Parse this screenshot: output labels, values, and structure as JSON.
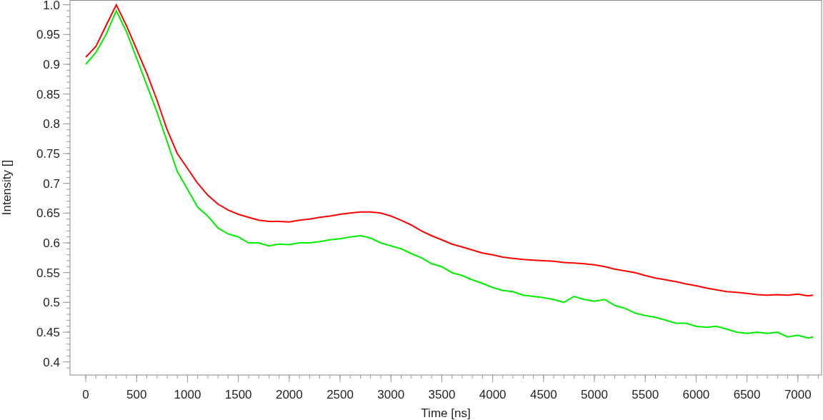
{
  "chart_data": {
    "type": "line",
    "xlabel": "Time [ns]",
    "ylabel": "Intensity []",
    "x": [
      0,
      100,
      200,
      300,
      400,
      500,
      600,
      700,
      800,
      900,
      1000,
      1100,
      1200,
      1300,
      1400,
      1500,
      1600,
      1700,
      1800,
      1900,
      2000,
      2100,
      2200,
      2300,
      2400,
      2500,
      2600,
      2700,
      2800,
      2900,
      3000,
      3100,
      3200,
      3300,
      3400,
      3500,
      3600,
      3700,
      3800,
      3900,
      4000,
      4100,
      4200,
      4300,
      4400,
      4500,
      4600,
      4700,
      4800,
      4900,
      5000,
      5100,
      5200,
      5300,
      5400,
      5500,
      5600,
      5700,
      5800,
      5900,
      6000,
      6100,
      6200,
      6300,
      6400,
      6500,
      6600,
      6700,
      6800,
      6900,
      7000,
      7100,
      7150
    ],
    "series": [
      {
        "color": "#ff0000",
        "values": [
          0.912,
          0.93,
          0.965,
          1.0,
          0.965,
          0.925,
          0.885,
          0.84,
          0.79,
          0.75,
          0.725,
          0.7,
          0.68,
          0.665,
          0.655,
          0.648,
          0.643,
          0.638,
          0.636,
          0.636,
          0.635,
          0.638,
          0.64,
          0.643,
          0.645,
          0.648,
          0.65,
          0.652,
          0.652,
          0.65,
          0.645,
          0.638,
          0.63,
          0.62,
          0.612,
          0.605,
          0.598,
          0.593,
          0.588,
          0.583,
          0.58,
          0.576,
          0.574,
          0.572,
          0.571,
          0.57,
          0.569,
          0.567,
          0.566,
          0.565,
          0.563,
          0.56,
          0.556,
          0.553,
          0.55,
          0.545,
          0.541,
          0.538,
          0.535,
          0.531,
          0.528,
          0.524,
          0.521,
          0.518,
          0.517,
          0.515,
          0.513,
          0.512,
          0.513,
          0.512,
          0.514,
          0.511,
          0.512
        ]
      },
      {
        "color": "#00ee00",
        "values": [
          0.9,
          0.92,
          0.95,
          0.99,
          0.955,
          0.91,
          0.865,
          0.82,
          0.77,
          0.72,
          0.69,
          0.66,
          0.645,
          0.625,
          0.615,
          0.61,
          0.6,
          0.6,
          0.595,
          0.598,
          0.597,
          0.6,
          0.6,
          0.602,
          0.605,
          0.607,
          0.61,
          0.612,
          0.608,
          0.6,
          0.595,
          0.59,
          0.582,
          0.575,
          0.565,
          0.56,
          0.55,
          0.545,
          0.538,
          0.532,
          0.525,
          0.52,
          0.518,
          0.512,
          0.51,
          0.508,
          0.505,
          0.5,
          0.51,
          0.505,
          0.502,
          0.505,
          0.495,
          0.49,
          0.482,
          0.478,
          0.475,
          0.47,
          0.465,
          0.465,
          0.46,
          0.458,
          0.46,
          0.455,
          0.45,
          0.448,
          0.45,
          0.448,
          0.45,
          0.442,
          0.445,
          0.44,
          0.442
        ]
      }
    ],
    "xlim": [
      -155,
      7233
    ],
    "ylim": [
      0.378,
      1.008
    ],
    "xticks": [
      0,
      500,
      1000,
      1500,
      2000,
      2500,
      3000,
      3500,
      4000,
      4500,
      5000,
      5500,
      6000,
      6500,
      7000
    ],
    "yticks": [
      0.4,
      0.45,
      0.5,
      0.55,
      0.6,
      0.65,
      0.7,
      0.75,
      0.8,
      0.85,
      0.9,
      0.95,
      {
        "value": 1,
        "label": "1.0"
      }
    ]
  }
}
